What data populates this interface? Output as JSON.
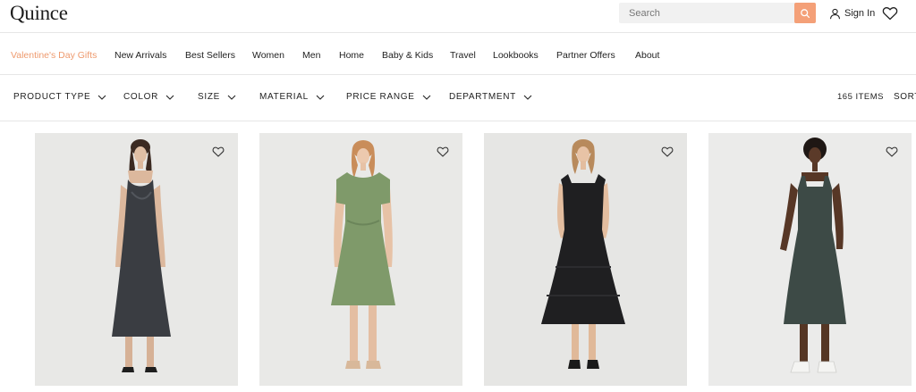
{
  "header": {
    "logo": "Quince",
    "search_placeholder": "Search",
    "signin_label": "Sign In"
  },
  "nav": {
    "items": [
      {
        "label": "Valentine's Day Gifts",
        "accent": true
      },
      {
        "label": "New Arrivals"
      },
      {
        "label": "Best Sellers"
      },
      {
        "label": "Women"
      },
      {
        "label": "Men"
      },
      {
        "label": "Home"
      },
      {
        "label": "Baby & Kids"
      },
      {
        "label": "Travel"
      },
      {
        "label": "Lookbooks"
      },
      {
        "label": "Partner Offers"
      },
      {
        "label": "About"
      }
    ]
  },
  "filters": {
    "items": [
      "PRODUCT TYPE",
      "COLOR",
      "SIZE",
      "MATERIAL",
      "PRICE RANGE",
      "DEPARTMENT"
    ],
    "count": "165 ITEMS",
    "sort_label": "SORT"
  },
  "products": [
    {
      "icon": "dress-photo",
      "dress_color": "#3a3d42"
    },
    {
      "icon": "dress-photo",
      "dress_color": "#7f9a6a"
    },
    {
      "icon": "dress-photo",
      "dress_color": "#1f1f21"
    },
    {
      "icon": "dress-photo",
      "dress_color": "#3d4a46"
    }
  ],
  "colors": {
    "accent": "#ee9a6e",
    "search_button": "#f4a078"
  }
}
